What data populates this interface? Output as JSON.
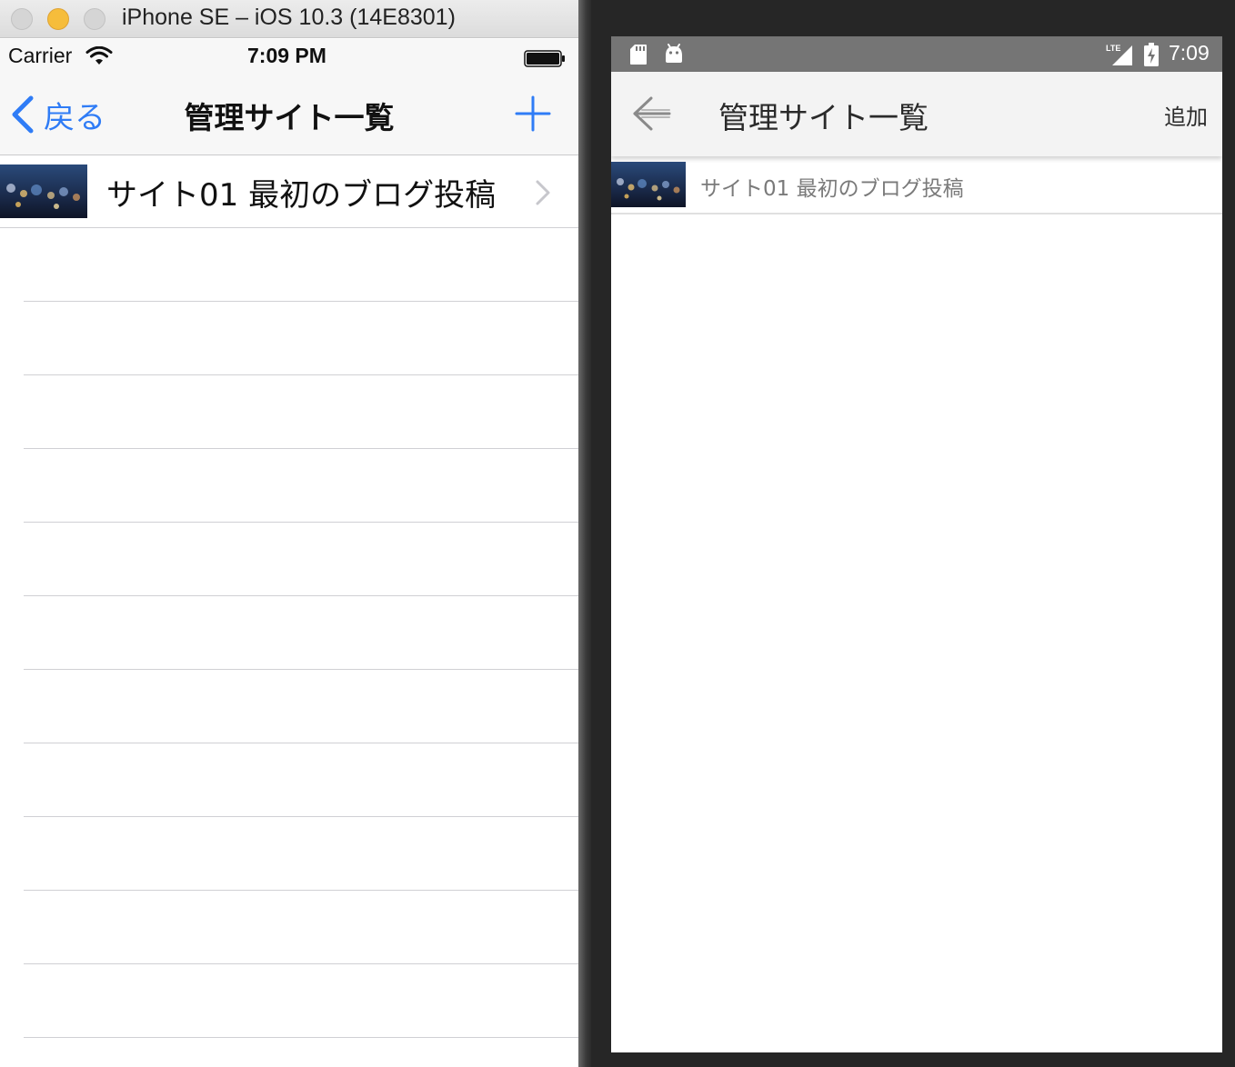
{
  "ios": {
    "window_title": "iPhone SE – iOS 10.3 (14E8301)",
    "status": {
      "carrier": "Carrier",
      "time": "7:09 PM"
    },
    "navbar": {
      "back_label": "戻る",
      "title": "管理サイト一覧"
    },
    "list": [
      {
        "label": "サイト01 最初のブログ投稿"
      }
    ],
    "empty_rows": 11
  },
  "android": {
    "status": {
      "time": "7:09",
      "network": "LTE"
    },
    "toolbar": {
      "title": "管理サイト一覧",
      "add_label": "追加"
    },
    "list": [
      {
        "label": "サイト01 最初のブログ投稿"
      }
    ]
  },
  "colors": {
    "ios_tint": "#2f7cf6",
    "android_status": "#757575",
    "android_toolbar": "#f3f3f3"
  }
}
